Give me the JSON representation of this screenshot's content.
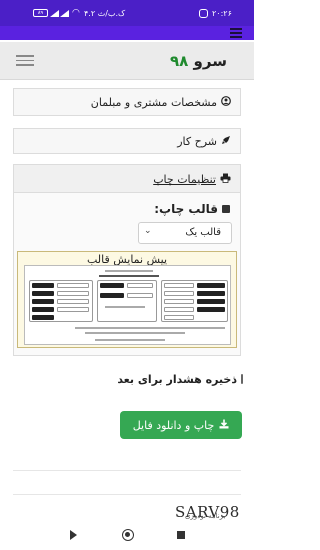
{
  "status_bar": {
    "time": "۲۰:۲۶",
    "network_speed": "۴.۲ ک.ب/ث",
    "battery": "۸۹"
  },
  "header": {
    "brand_text": "سرو",
    "brand_number": "۹۸"
  },
  "panels": {
    "customer": {
      "title": "مشخصات مشتری و مبلمان",
      "icon": "user-circle-icon"
    },
    "description": {
      "title": "شرح کار",
      "icon": "rocket-icon"
    },
    "print_settings": {
      "title": "تنظیمات چاپ",
      "icon": "printer-icon"
    }
  },
  "print_settings": {
    "template_label": "قالب چاپ:",
    "template_value": "قالب یک",
    "preview_title": "پیش نمایش قالب"
  },
  "save_warning_label": "ذخیره هشدار برای بعد",
  "print_button_label": "چاپ و دانلود فایل",
  "watermark": {
    "main": "SARV98",
    "sub": "برنامه تودوزی"
  },
  "colors": {
    "status_bar": "#4b1fc7",
    "app_strip": "#5a22e0",
    "brand_number": "#1f8a2e",
    "print_button": "#35a853"
  }
}
